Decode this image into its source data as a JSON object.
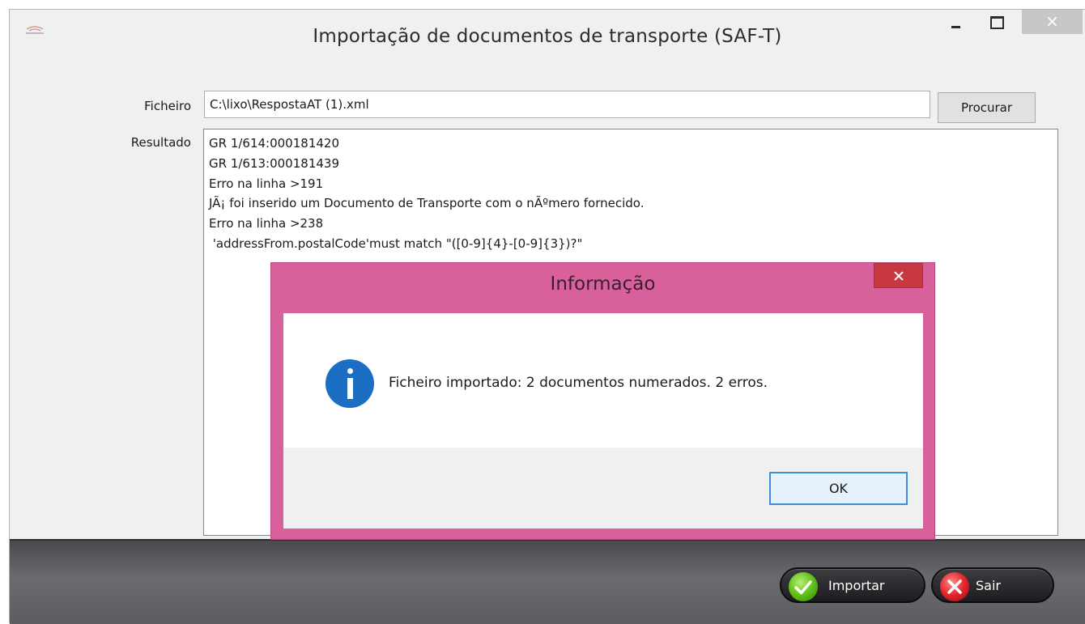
{
  "window": {
    "title": "Importação de documentos de transporte (SAF-T)",
    "close_glyph": "×"
  },
  "form": {
    "file_label": "Ficheiro",
    "file_value": "C:\\lixo\\RespostaAT (1).xml",
    "browse_label": "Procurar",
    "result_label": "Resultado",
    "result_lines": [
      "GR 1/614:000181420",
      "GR 1/613:000181439",
      "Erro na linha >191",
      "JÃ¡ foi inserido um Documento de Transporte com o nÃºmero fornecido.",
      "Erro na linha >238",
      " 'addressFrom.postalCode'must match \"([0-9]{4}-[0-9]{3})?\""
    ]
  },
  "toolbar": {
    "import_label": "Importar",
    "exit_label": "Sair"
  },
  "dialog": {
    "title": "Informação",
    "message": "Ficheiro importado: 2 documentos numerados. 2 erros.",
    "ok_label": "OK",
    "accent_color": "#d9619b"
  },
  "icons": {
    "app": "app-logo-icon",
    "minimize": "minimize-icon",
    "maximize": "maximize-icon",
    "close": "close-icon",
    "info": "info-icon",
    "import": "check-icon",
    "exit": "x-icon"
  }
}
